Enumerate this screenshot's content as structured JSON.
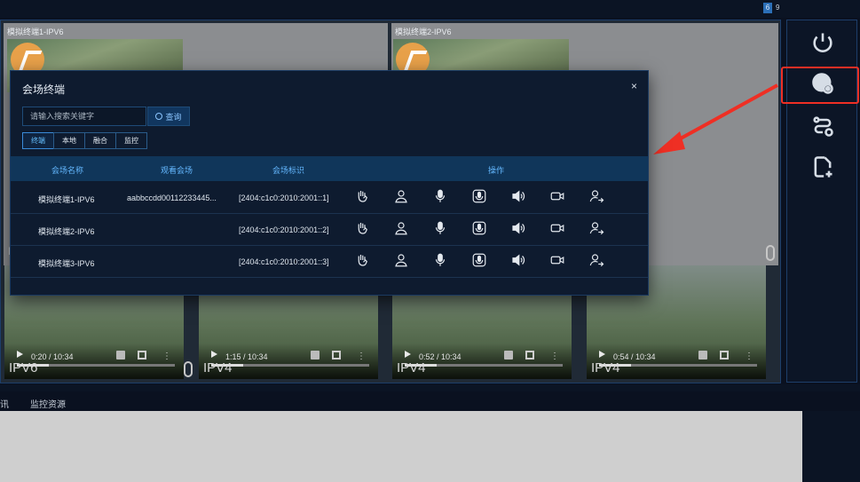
{
  "topbar": {
    "badge_count": "6",
    "badge_secondary": "9"
  },
  "tiles": [
    {
      "label": "模拟终端1-IPV6"
    },
    {
      "label": "模拟终端2-IPV6"
    }
  ],
  "videos": [
    {
      "time": "0:20 / 10:34",
      "tag": "IPV6"
    },
    {
      "time": "1:15 / 10:34",
      "tag": "IPV4"
    },
    {
      "time": "0:52 / 10:34",
      "tag": "IPV4"
    },
    {
      "time": "0:54 / 10:34",
      "tag": "IPV4"
    }
  ],
  "hidden_tag": "IP",
  "bottom_tabs": [
    "讯",
    "监控资源"
  ],
  "side_buttons": [
    "power-icon",
    "globe-settings-icon",
    "route-settings-icon",
    "add-file-icon"
  ],
  "modal": {
    "title": "会场终端",
    "close": "×",
    "search_placeholder": "请输入搜索关键字",
    "search_button": "查询",
    "tabs": [
      "终端",
      "本地",
      "融合",
      "监控"
    ],
    "headers": {
      "name": "会场名称",
      "watch": "观看会场",
      "id": "会场标识",
      "ops": "操作"
    },
    "rows": [
      {
        "name": "模拟终端1-IPV6",
        "watch": "aabbccdd00112233445...",
        "id": "[2404:c1c0:2010:2001::1]"
      },
      {
        "name": "模拟终端2-IPV6",
        "watch": "",
        "id": "[2404:c1c0:2010:2001::2]"
      },
      {
        "name": "模拟终端3-IPV6",
        "watch": "",
        "id": "[2404:c1c0:2010:2001::3]"
      }
    ],
    "ops_icons": [
      "hand-raise-icon",
      "user-icon",
      "microphone-icon",
      "speaker-booth-icon",
      "volume-icon",
      "camera-icon",
      "user-transfer-icon"
    ]
  },
  "colors": {
    "accent": "#64b8ff",
    "highlight": "#ef2f24",
    "panel": "#0e1b2f"
  }
}
